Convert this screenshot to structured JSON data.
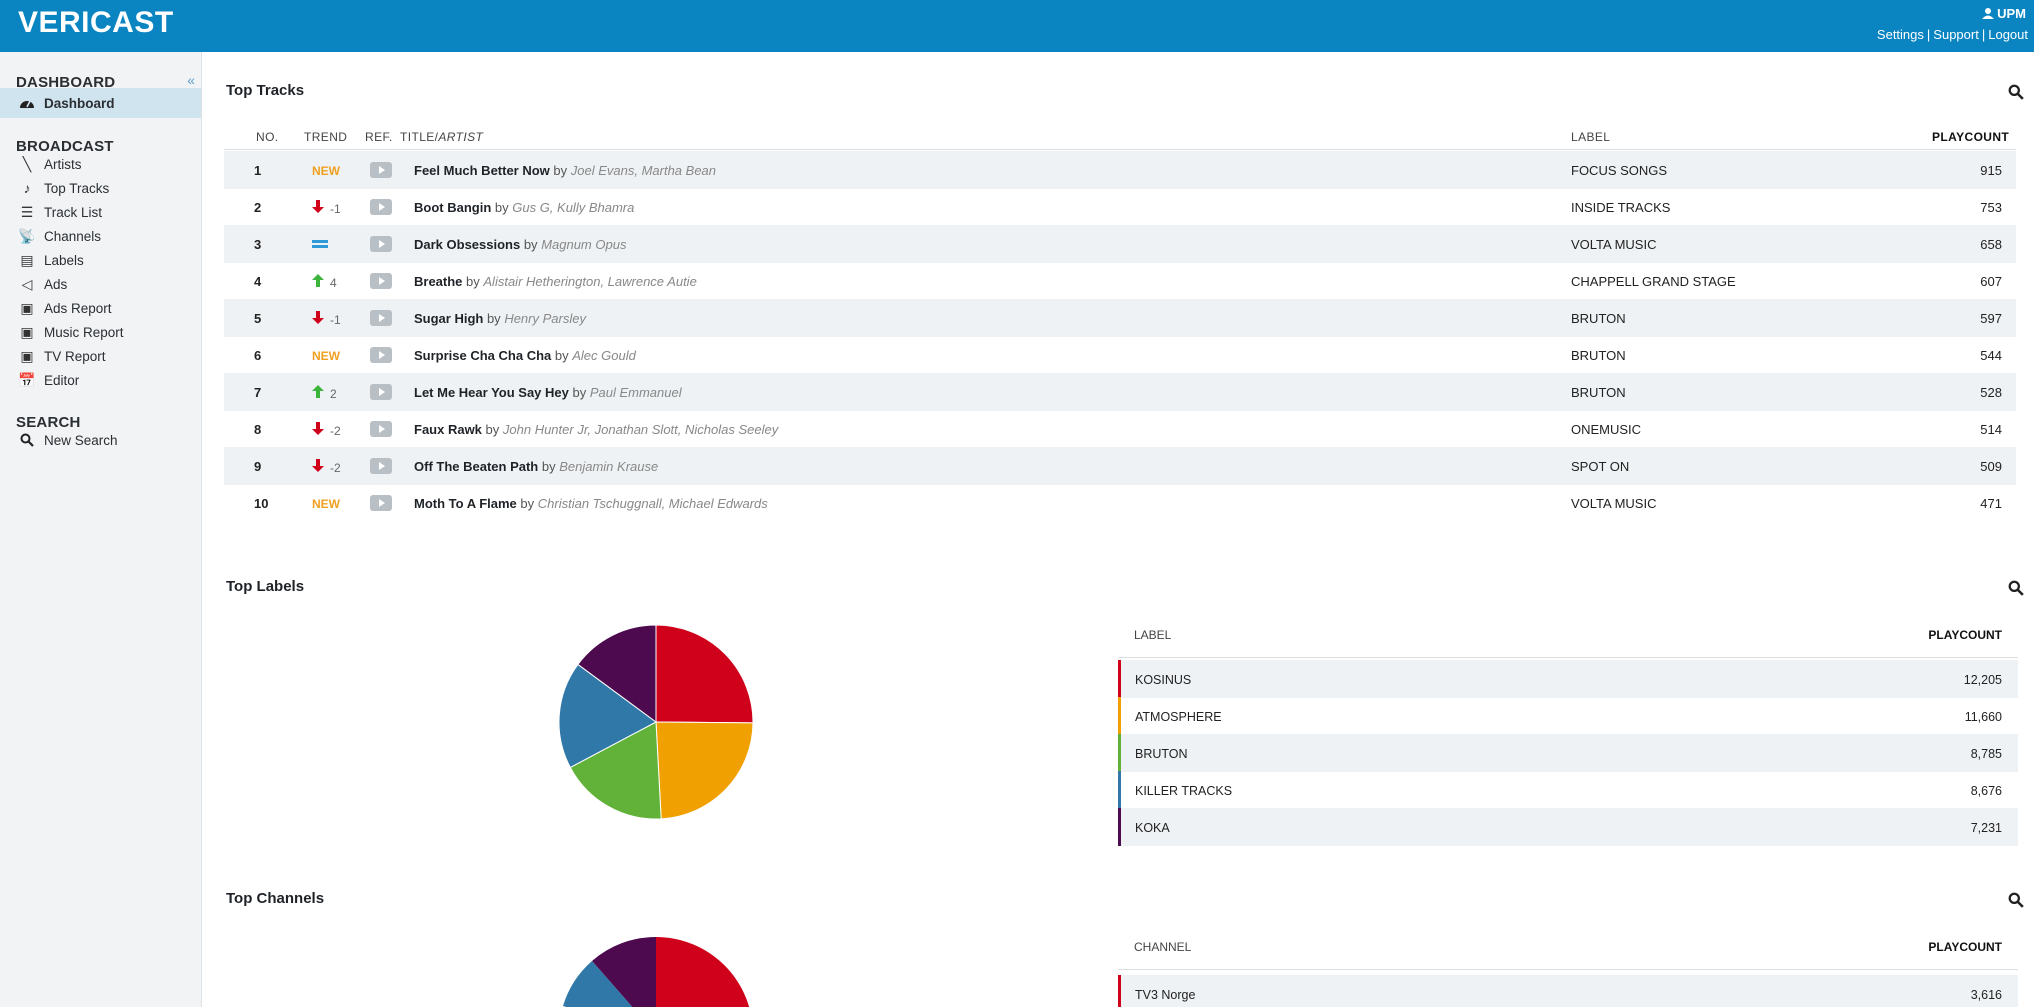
{
  "header": {
    "brand": "VERICAST",
    "user": "UPM",
    "links": [
      "Settings",
      "Support",
      "Logout"
    ],
    "color": "#0a85c2"
  },
  "sidebar": {
    "collapse_glyph": "«",
    "sections": [
      {
        "title": "DASHBOARD",
        "items": [
          {
            "label": "Dashboard",
            "icon": "dashboard-icon",
            "active": true
          }
        ]
      },
      {
        "title": "BROADCAST",
        "items": [
          {
            "label": "Artists",
            "icon": "artist-icon"
          },
          {
            "label": "Top Tracks",
            "icon": "music-note-icon"
          },
          {
            "label": "Track List",
            "icon": "track-list-icon"
          },
          {
            "label": "Channels",
            "icon": "broadcast-tower-icon"
          },
          {
            "label": "Labels",
            "icon": "labels-icon"
          },
          {
            "label": "Ads",
            "icon": "megaphone-icon"
          },
          {
            "label": "Ads Report",
            "icon": "ads-report-icon"
          },
          {
            "label": "Music Report",
            "icon": "music-report-icon"
          },
          {
            "label": "TV Report",
            "icon": "tv-report-icon"
          },
          {
            "label": "Editor",
            "icon": "editor-icon"
          }
        ]
      },
      {
        "title": "SEARCH",
        "items": [
          {
            "label": "New Search",
            "icon": "search-icon"
          }
        ]
      }
    ]
  },
  "top_tracks": {
    "title": "Top Tracks",
    "columns": {
      "no": "NO.",
      "trend": "TREND",
      "ref": "REF.",
      "title": "TITLE/",
      "artist": "ARTIST",
      "label": "LABEL",
      "playcount": "PLAYCOUNT"
    },
    "by_word": "by",
    "rows": [
      {
        "no": "1",
        "trend": "new",
        "trend_text": "NEW",
        "title": "Feel Much Better Now",
        "artist": "Joel Evans, Martha Bean",
        "label": "FOCUS SONGS",
        "playcount": "915"
      },
      {
        "no": "2",
        "trend": "down",
        "trend_text": "-1",
        "title": "Boot Bangin",
        "artist": "Gus G, Kully Bhamra",
        "label": "INSIDE TRACKS",
        "playcount": "753"
      },
      {
        "no": "3",
        "trend": "same",
        "trend_text": "",
        "title": "Dark Obsessions",
        "artist": "Magnum Opus",
        "label": "VOLTA MUSIC",
        "playcount": "658"
      },
      {
        "no": "4",
        "trend": "up",
        "trend_text": "4",
        "title": "Breathe",
        "artist": "Alistair Hetherington, Lawrence Autie",
        "label": "CHAPPELL GRAND STAGE",
        "playcount": "607"
      },
      {
        "no": "5",
        "trend": "down",
        "trend_text": "-1",
        "title": "Sugar High",
        "artist": "Henry Parsley",
        "label": "BRUTON",
        "playcount": "597"
      },
      {
        "no": "6",
        "trend": "new",
        "trend_text": "NEW",
        "title": "Surprise Cha Cha Cha",
        "artist": "Alec Gould",
        "label": "BRUTON",
        "playcount": "544"
      },
      {
        "no": "7",
        "trend": "up",
        "trend_text": "2",
        "title": "Let Me Hear You Say Hey",
        "artist": "Paul Emmanuel",
        "label": "BRUTON",
        "playcount": "528"
      },
      {
        "no": "8",
        "trend": "down",
        "trend_text": "-2",
        "title": "Faux Rawk",
        "artist": "John Hunter Jr, Jonathan Slott, Nicholas Seeley",
        "label": "ONEMUSIC",
        "playcount": "514"
      },
      {
        "no": "9",
        "trend": "down",
        "trend_text": "-2",
        "title": "Off The Beaten Path",
        "artist": "Benjamin Krause",
        "label": "SPOT ON",
        "playcount": "509"
      },
      {
        "no": "10",
        "trend": "new",
        "trend_text": "NEW",
        "title": "Moth To A Flame",
        "artist": "Christian Tschuggnall, Michael Edwards",
        "label": "VOLTA MUSIC",
        "playcount": "471"
      }
    ]
  },
  "top_labels": {
    "title": "Top Labels",
    "columns": {
      "name": "LABEL",
      "playcount": "PLAYCOUNT"
    },
    "rows": [
      {
        "name": "KOSINUS",
        "playcount": "12,205",
        "color": "#d0021b"
      },
      {
        "name": "ATMOSPHERE",
        "playcount": "11,660",
        "color": "#f0a000"
      },
      {
        "name": "BRUTON",
        "playcount": "8,785",
        "color": "#62b23a"
      },
      {
        "name": "KILLER TRACKS",
        "playcount": "8,676",
        "color": "#2f78a8"
      },
      {
        "name": "KOKA",
        "playcount": "7,231",
        "color": "#4d0a4e"
      }
    ]
  },
  "top_channels": {
    "title": "Top Channels",
    "columns": {
      "name": "CHANNEL",
      "playcount": "PLAYCOUNT"
    },
    "rows": [
      {
        "name": "TV3 Norge",
        "playcount": "3,616",
        "color": "#d0021b"
      }
    ],
    "pie_colors": [
      "#d0021b",
      "#4d0a4e",
      "#2f78a8"
    ]
  },
  "chart_data": [
    {
      "type": "pie",
      "title": "Top Labels",
      "categories": [
        "KOSINUS",
        "ATMOSPHERE",
        "BRUTON",
        "KILLER TRACKS",
        "KOKA"
      ],
      "values": [
        12205,
        11660,
        8785,
        8676,
        7231
      ],
      "colors": [
        "#d0021b",
        "#f0a000",
        "#62b23a",
        "#2f78a8",
        "#4d0a4e"
      ]
    }
  ]
}
